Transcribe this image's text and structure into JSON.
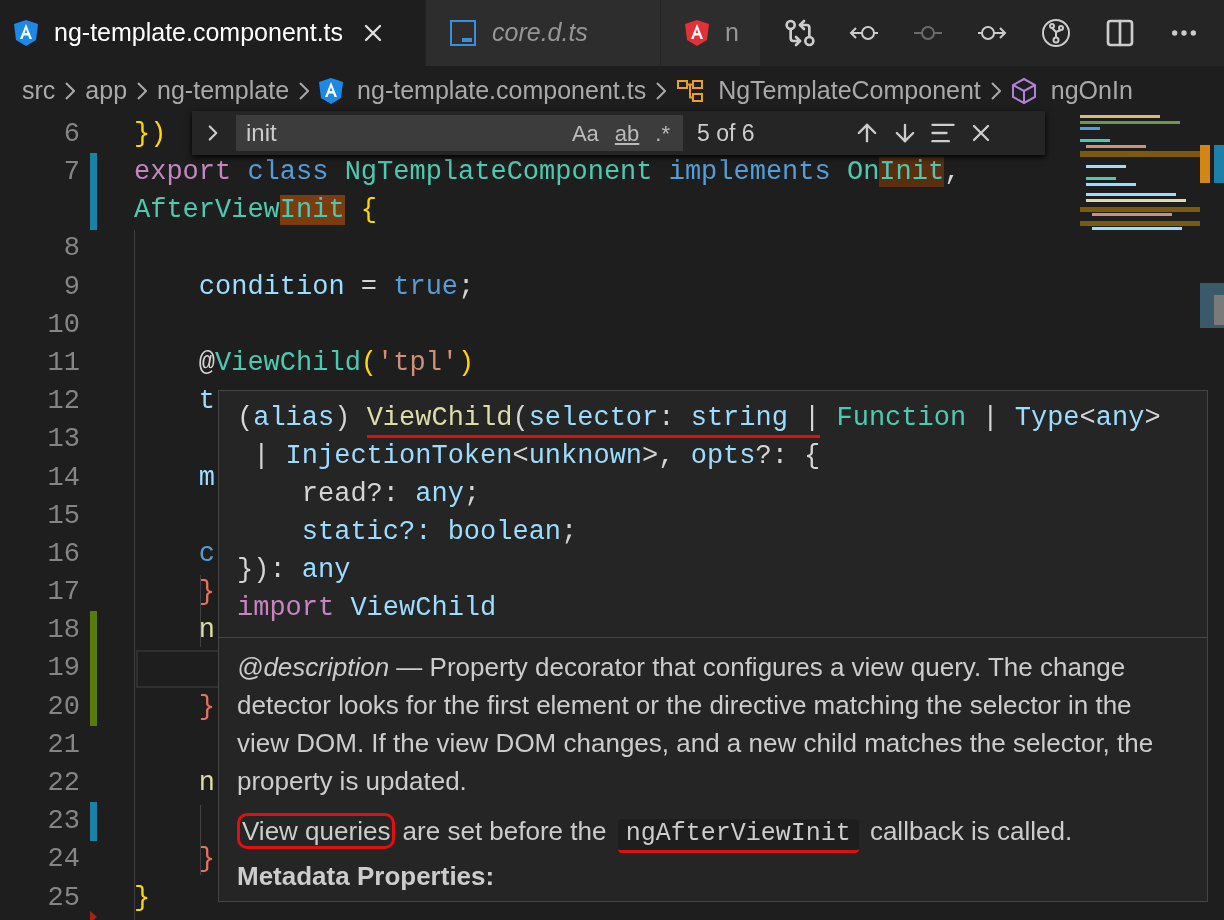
{
  "tabs": [
    {
      "label": "ng-template.component.ts",
      "kind": "angular",
      "selected": true,
      "preview": false
    },
    {
      "label": "core.d.ts",
      "kind": "typescript",
      "selected": false,
      "preview": true
    },
    {
      "label": "n",
      "kind": "angular-red",
      "selected": false,
      "preview": false
    }
  ],
  "toolbar": [
    {
      "kind": "compare",
      "disabled": false
    },
    {
      "kind": "previous",
      "disabled": false
    },
    {
      "kind": "commit",
      "disabled": true
    },
    {
      "kind": "next",
      "disabled": false
    },
    {
      "kind": "source-control",
      "disabled": false
    },
    {
      "kind": "split",
      "disabled": false
    },
    {
      "kind": "more",
      "disabled": false
    }
  ],
  "breadcrumb": [
    {
      "label": "src",
      "kind": "folder"
    },
    {
      "label": "app",
      "kind": "folder"
    },
    {
      "label": "ng-template",
      "kind": "folder"
    },
    {
      "label": "ng-template.component.ts",
      "kind": "angular"
    },
    {
      "label": "NgTemplateComponent",
      "kind": "class"
    },
    {
      "label": "ngOnIn",
      "kind": "method"
    }
  ],
  "find": {
    "value": "init",
    "count": "5 of 6",
    "toggles": [
      {
        "label": "Aa",
        "on": false
      },
      {
        "label": "ab",
        "on": false
      },
      {
        "label": ".*",
        "on": false
      }
    ]
  },
  "lines": [
    {
      "number": "6",
      "kind": "plain",
      "current": false,
      "tokens": [
        {
          "text": "})",
          "kind": "brace"
        }
      ]
    },
    {
      "number": "7",
      "kind": "modified",
      "current": false,
      "tokens": [
        {
          "text": "export ",
          "kind": "keyword2"
        },
        {
          "text": "class ",
          "kind": "keyword"
        },
        {
          "text": "NgTemplateComponent ",
          "kind": "type"
        },
        {
          "text": "implements ",
          "kind": "keyword"
        },
        {
          "text": "On",
          "kind": "type"
        },
        {
          "text": "Init",
          "kind": "type",
          "match": true,
          "active_match": false
        },
        {
          "text": ",",
          "kind": "plain"
        }
      ],
      "wrapped_tokens": [
        {
          "text": "AfterView",
          "kind": "type"
        },
        {
          "text": "Init",
          "kind": "type",
          "match": true,
          "active_match": true
        },
        {
          "text": " {",
          "kind": "brace"
        }
      ]
    },
    {
      "number": "8",
      "kind": "plain",
      "current": false
    },
    {
      "number": "9",
      "kind": "plain",
      "current": false,
      "tokens": [
        {
          "text": "    condition",
          "kind": "property"
        },
        {
          "text": " = ",
          "kind": "plain"
        },
        {
          "text": "true",
          "kind": "keyword"
        },
        {
          "text": ";",
          "kind": "plain"
        }
      ]
    },
    {
      "number": "10",
      "kind": "plain",
      "current": false
    },
    {
      "number": "11",
      "kind": "plain",
      "current": false,
      "tokens": [
        {
          "text": "    @",
          "kind": "plain"
        },
        {
          "text": "ViewChild",
          "kind": "type"
        },
        {
          "text": "(",
          "kind": "brace"
        },
        {
          "text": "'tpl'",
          "kind": "string"
        },
        {
          "text": ")",
          "kind": "brace"
        }
      ]
    },
    {
      "number": "12",
      "kind": "plain",
      "current": false,
      "tokens": [
        {
          "text": "    t",
          "kind": "property"
        }
      ]
    },
    {
      "number": "13",
      "kind": "plain",
      "current": false
    },
    {
      "number": "14",
      "kind": "plain",
      "current": false,
      "tokens": [
        {
          "text": "    m",
          "kind": "property"
        }
      ]
    },
    {
      "number": "15",
      "kind": "plain",
      "current": false
    },
    {
      "number": "16",
      "kind": "plain",
      "current": false,
      "tokens": [
        {
          "text": "    c",
          "kind": "keyword"
        }
      ]
    },
    {
      "number": "17",
      "kind": "plain",
      "current": false,
      "tokens": [
        {
          "text": "    }",
          "kind": "brace_error"
        }
      ]
    },
    {
      "number": "18",
      "kind": "added",
      "current": false,
      "tokens": [
        {
          "text": "    n",
          "kind": "function"
        }
      ]
    },
    {
      "number": "19",
      "kind": "added",
      "current": true
    },
    {
      "number": "20",
      "kind": "added",
      "current": false,
      "tokens": [
        {
          "text": "    }",
          "kind": "brace_error"
        }
      ]
    },
    {
      "number": "21",
      "kind": "plain",
      "current": false
    },
    {
      "number": "22",
      "kind": "plain",
      "current": false,
      "tokens": [
        {
          "text": "    n",
          "kind": "function"
        }
      ]
    },
    {
      "number": "23",
      "kind": "modified",
      "current": false
    },
    {
      "number": "24",
      "kind": "plain",
      "current": false,
      "tokens": [
        {
          "text": "    }",
          "kind": "brace_error"
        }
      ]
    },
    {
      "number": "25",
      "kind": "deleted",
      "current": false,
      "tokens": [
        {
          "text": "}",
          "kind": "brace"
        }
      ]
    }
  ],
  "hover": {
    "signature": [
      [
        {
          "text": "(",
          "kind": "plain",
          "underlined": false
        },
        {
          "text": "alias",
          "kind": "property",
          "underlined": false
        },
        {
          "text": ") ",
          "kind": "plain",
          "underlined": false
        },
        {
          "text": "ViewChild",
          "kind": "function",
          "underlined": true
        },
        {
          "text": "(",
          "kind": "plain",
          "underlined": true
        },
        {
          "text": "selector",
          "kind": "property",
          "underlined": true
        },
        {
          "text": ": ",
          "kind": "plain",
          "underlined": true
        },
        {
          "text": "string",
          "kind": "property",
          "underlined": true
        },
        {
          "text": " |",
          "kind": "plain",
          "underlined": true
        },
        {
          "text": " Function",
          "kind": "type",
          "underlined": false
        },
        {
          "text": " | ",
          "kind": "plain",
          "underlined": false
        },
        {
          "text": "Type",
          "kind": "property",
          "underlined": false
        },
        {
          "text": "<",
          "kind": "plain",
          "underlined": false
        },
        {
          "text": "any",
          "kind": "property",
          "underlined": false
        },
        {
          "text": ">",
          "kind": "plain",
          "underlined": false
        }
      ],
      [
        {
          "text": " | ",
          "kind": "plain",
          "underlined": false
        },
        {
          "text": "InjectionToken",
          "kind": "property",
          "underlined": false
        },
        {
          "text": "<",
          "kind": "plain",
          "underlined": false
        },
        {
          "text": "unknown",
          "kind": "property",
          "underlined": false
        },
        {
          "text": ">, ",
          "kind": "plain",
          "underlined": false
        },
        {
          "text": "opts",
          "kind": "property",
          "underlined": false
        },
        {
          "text": "?: {",
          "kind": "plain",
          "underlined": false
        }
      ],
      [
        {
          "text": "    read?: ",
          "kind": "plain",
          "underlined": false
        },
        {
          "text": "any",
          "kind": "property",
          "underlined": false
        },
        {
          "text": ";",
          "kind": "plain",
          "underlined": false
        }
      ],
      [
        {
          "text": "    static?: ",
          "kind": "property",
          "underlined": false
        },
        {
          "text": "boolean",
          "kind": "property",
          "underlined": false
        },
        {
          "text": ";",
          "kind": "plain",
          "underlined": false
        }
      ],
      [
        {
          "text": "}): ",
          "kind": "plain",
          "underlined": false
        },
        {
          "text": "any",
          "kind": "property",
          "underlined": false
        }
      ],
      [
        {
          "text": "import ",
          "kind": "keyword2",
          "underlined": false
        },
        {
          "text": "ViewChild",
          "kind": "property",
          "underlined": false
        }
      ]
    ],
    "description": "*@description* — Property decorator that configures a view query. The change detector looks for the first element or the directive matching the selector in the view DOM. If the view DOM changes, and a new child matches the selector, the property is updated.",
    "note": [
      {
        "text": "View queries",
        "kind": "circled"
      },
      {
        "text": " are set before the ",
        "kind": "plain"
      },
      {
        "text": "ngAfterViewInit",
        "kind": "code"
      },
      {
        "text": " callback is called.",
        "kind": "plain"
      }
    ],
    "heading": "Metadata Properties:"
  }
}
